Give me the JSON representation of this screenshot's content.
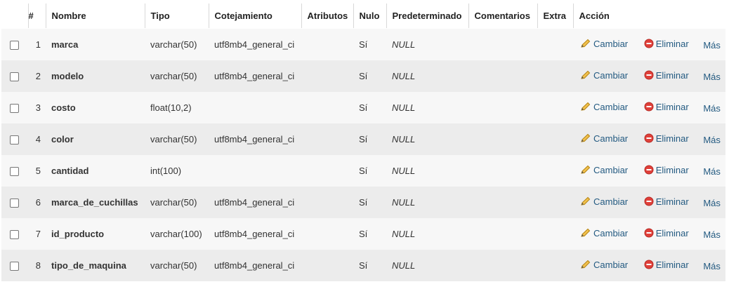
{
  "headers": {
    "num": "#",
    "nombre": "Nombre",
    "tipo": "Tipo",
    "cotejamiento": "Cotejamiento",
    "atributos": "Atributos",
    "nulo": "Nulo",
    "predeterminado": "Predeterminado",
    "comentarios": "Comentarios",
    "extra": "Extra",
    "accion": "Acción"
  },
  "actions": {
    "change_label": "Cambiar",
    "change_icon": "pencil-icon",
    "drop_label": "Eliminar",
    "drop_icon": "drop-icon",
    "more_label": "Más"
  },
  "rows": [
    {
      "num": "1",
      "name": "marca",
      "type": "varchar(50)",
      "collation": "utf8mb4_general_ci",
      "null": "Sí",
      "default": "NULL"
    },
    {
      "num": "2",
      "name": "modelo",
      "type": "varchar(50)",
      "collation": "utf8mb4_general_ci",
      "null": "Sí",
      "default": "NULL"
    },
    {
      "num": "3",
      "name": "costo",
      "type": "float(10,2)",
      "collation": "",
      "null": "Sí",
      "default": "NULL"
    },
    {
      "num": "4",
      "name": "color",
      "type": "varchar(50)",
      "collation": "utf8mb4_general_ci",
      "null": "Sí",
      "default": "NULL"
    },
    {
      "num": "5",
      "name": "cantidad",
      "type": "int(100)",
      "collation": "",
      "null": "Sí",
      "default": "NULL"
    },
    {
      "num": "6",
      "name": "marca_de_cuchillas",
      "type": "varchar(50)",
      "collation": "utf8mb4_general_ci",
      "null": "Sí",
      "default": "NULL"
    },
    {
      "num": "7",
      "name": "id_producto",
      "type": "varchar(100)",
      "collation": "utf8mb4_general_ci",
      "null": "Sí",
      "default": "NULL"
    },
    {
      "num": "8",
      "name": "tipo_de_maquina",
      "type": "varchar(50)",
      "collation": "utf8mb4_general_ci",
      "null": "Sí",
      "default": "NULL"
    }
  ],
  "colors": {
    "link": "#235a81",
    "row_odd": "#f7f7f7",
    "row_even": "#ececec",
    "drop_icon": "#e0403a",
    "pencil_icon": "#d9a421"
  }
}
